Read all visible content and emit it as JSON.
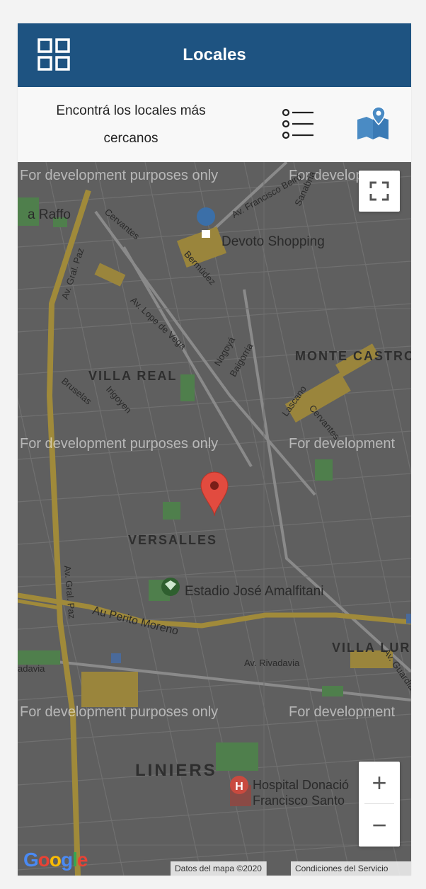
{
  "header": {
    "title": "Locales"
  },
  "subbar": {
    "description": "Encontrá los locales más cercanos",
    "icons": [
      "list-view-icon",
      "map-view-icon"
    ]
  },
  "map": {
    "watermark": "For development purposes only",
    "watermark_partial": "For development",
    "neighborhoods": [
      "VILLA REAL",
      "MONTE CASTRO",
      "VERSALLES",
      "VILLA LURO",
      "LINIERS"
    ],
    "streets": {
      "gral_paz": "Av. Gral. Paz",
      "cervantes": "Cervantes",
      "beiro": "Av. Francisco Beiró",
      "sanabria": "Sanabria",
      "bermudez": "Bermúdez",
      "lope_de_vega": "Av. Lope de Vega",
      "nogoya": "Nogoyá",
      "baigorria": "Baigorria",
      "bruselas": "Bruselas",
      "irigoyen": "Irigoyen",
      "lascano": "Lascano",
      "perito_moreno": "Au Perito Moreno",
      "rivadavia": "Av. Rivadavia",
      "guardia_nacional": "Av. Guardia Nac",
      "raffo": "a Raffo",
      "rivadavia_partial": "adavia"
    },
    "pois": {
      "devoto": "Devoto Shopping",
      "estadio": "Estadio José Amalfitani",
      "hospital_line1": "Hospital Donació",
      "hospital_line2": "Francisco Santo"
    },
    "google_logo": "Google",
    "attribution_data": "Datos del mapa ©2020",
    "attribution_terms": "Condiciones del Servicio",
    "zoom_in": "+",
    "zoom_out": "−",
    "colors": {
      "park": "#4f7f4c",
      "road_major": "#a08a3a",
      "road": "#7a7a7a",
      "marker": "#e24b3f"
    }
  }
}
